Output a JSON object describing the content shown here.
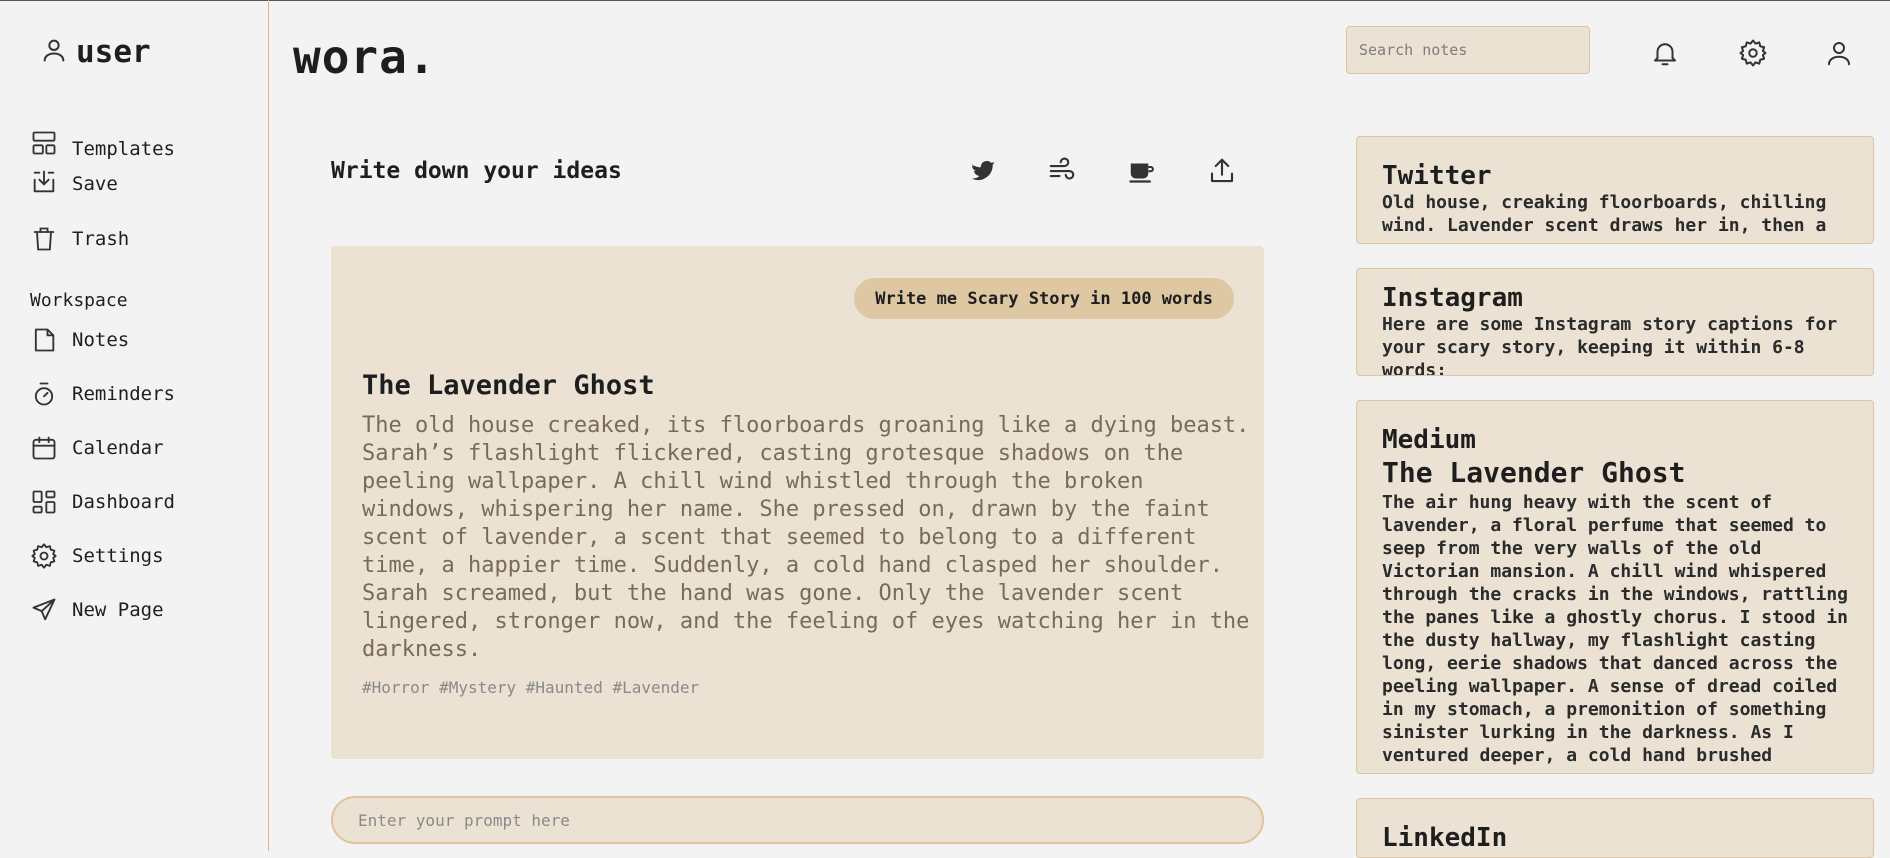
{
  "sidebar": {
    "user_label": "user",
    "items": [
      {
        "label": "Templates"
      },
      {
        "label": "Save"
      },
      {
        "label": "Trash"
      }
    ],
    "workspace_label": "Workspace",
    "workspace_items": [
      {
        "label": "Notes"
      },
      {
        "label": "Reminders"
      },
      {
        "label": "Calendar"
      },
      {
        "label": "Dashboard"
      },
      {
        "label": "Settings"
      },
      {
        "label": "New Page"
      }
    ]
  },
  "header": {
    "brand": "wora.",
    "search_placeholder": "Search notes"
  },
  "main": {
    "title": "Write down your ideas",
    "prompt_chip": "Write me Scary Story in 100 words",
    "story_title": "The Lavender Ghost",
    "story_body": "The old house creaked, its floorboards groaning like a dying beast. Sarah’s flashlight flickered, casting grotesque shadows on the peeling wallpaper. A chill wind whistled through the broken windows, whispering her name. She pressed on, drawn by the faint scent of lavender, a scent that seemed to belong to a different time, a happier time. Suddenly, a cold hand clasped her shoulder. Sarah screamed, but the hand was gone. Only the lavender scent lingered, stronger now, and the feeling of eyes watching her in the darkness.",
    "tags": "#Horror #Mystery #Haunted #Lavender",
    "prompt_placeholder": "Enter your prompt here"
  },
  "right_panel": {
    "twitter": {
      "title": "Twitter",
      "text": "Old house, creaking floorboards, chilling wind. Lavender scent draws her in, then a"
    },
    "instagram": {
      "title": "Instagram",
      "text": "Here are some Instagram story captions for your scary story, keeping it within 6-8 words:"
    },
    "medium": {
      "title": "Medium",
      "subtitle": "The Lavender Ghost",
      "text": "The air hung heavy with the scent of lavender, a floral perfume that seemed to seep from the very walls of the old Victorian mansion. A chill wind whispered through the cracks in the windows, rattling the panes like a ghostly chorus. I stood in the dusty hallway, my flashlight casting long, eerie shadows that danced across the peeling wallpaper. A sense of dread coiled in my stomach, a premonition of something sinister lurking in the darkness. As I ventured deeper, a cold hand brushed"
    },
    "linkedin": {
      "title": "LinkedIn"
    }
  },
  "icons": {
    "user": "user-icon",
    "templates": "layout-icon",
    "save": "download-icon",
    "trash": "trash-icon",
    "notes": "file-icon",
    "reminders": "timer-icon",
    "calendar": "calendar-icon",
    "dashboard": "dashboard-icon",
    "settings": "gear-icon",
    "new_page": "send-icon",
    "bell": "bell-icon",
    "profile": "user-icon",
    "twitter": "bird-icon",
    "wind": "wind-icon",
    "coffee": "coffee-icon",
    "share": "share-icon"
  },
  "colors": {
    "accent": "#dec7a3",
    "card": "#ebe2d4",
    "border": "#d8b98f",
    "body_text": "#7a6a58"
  }
}
